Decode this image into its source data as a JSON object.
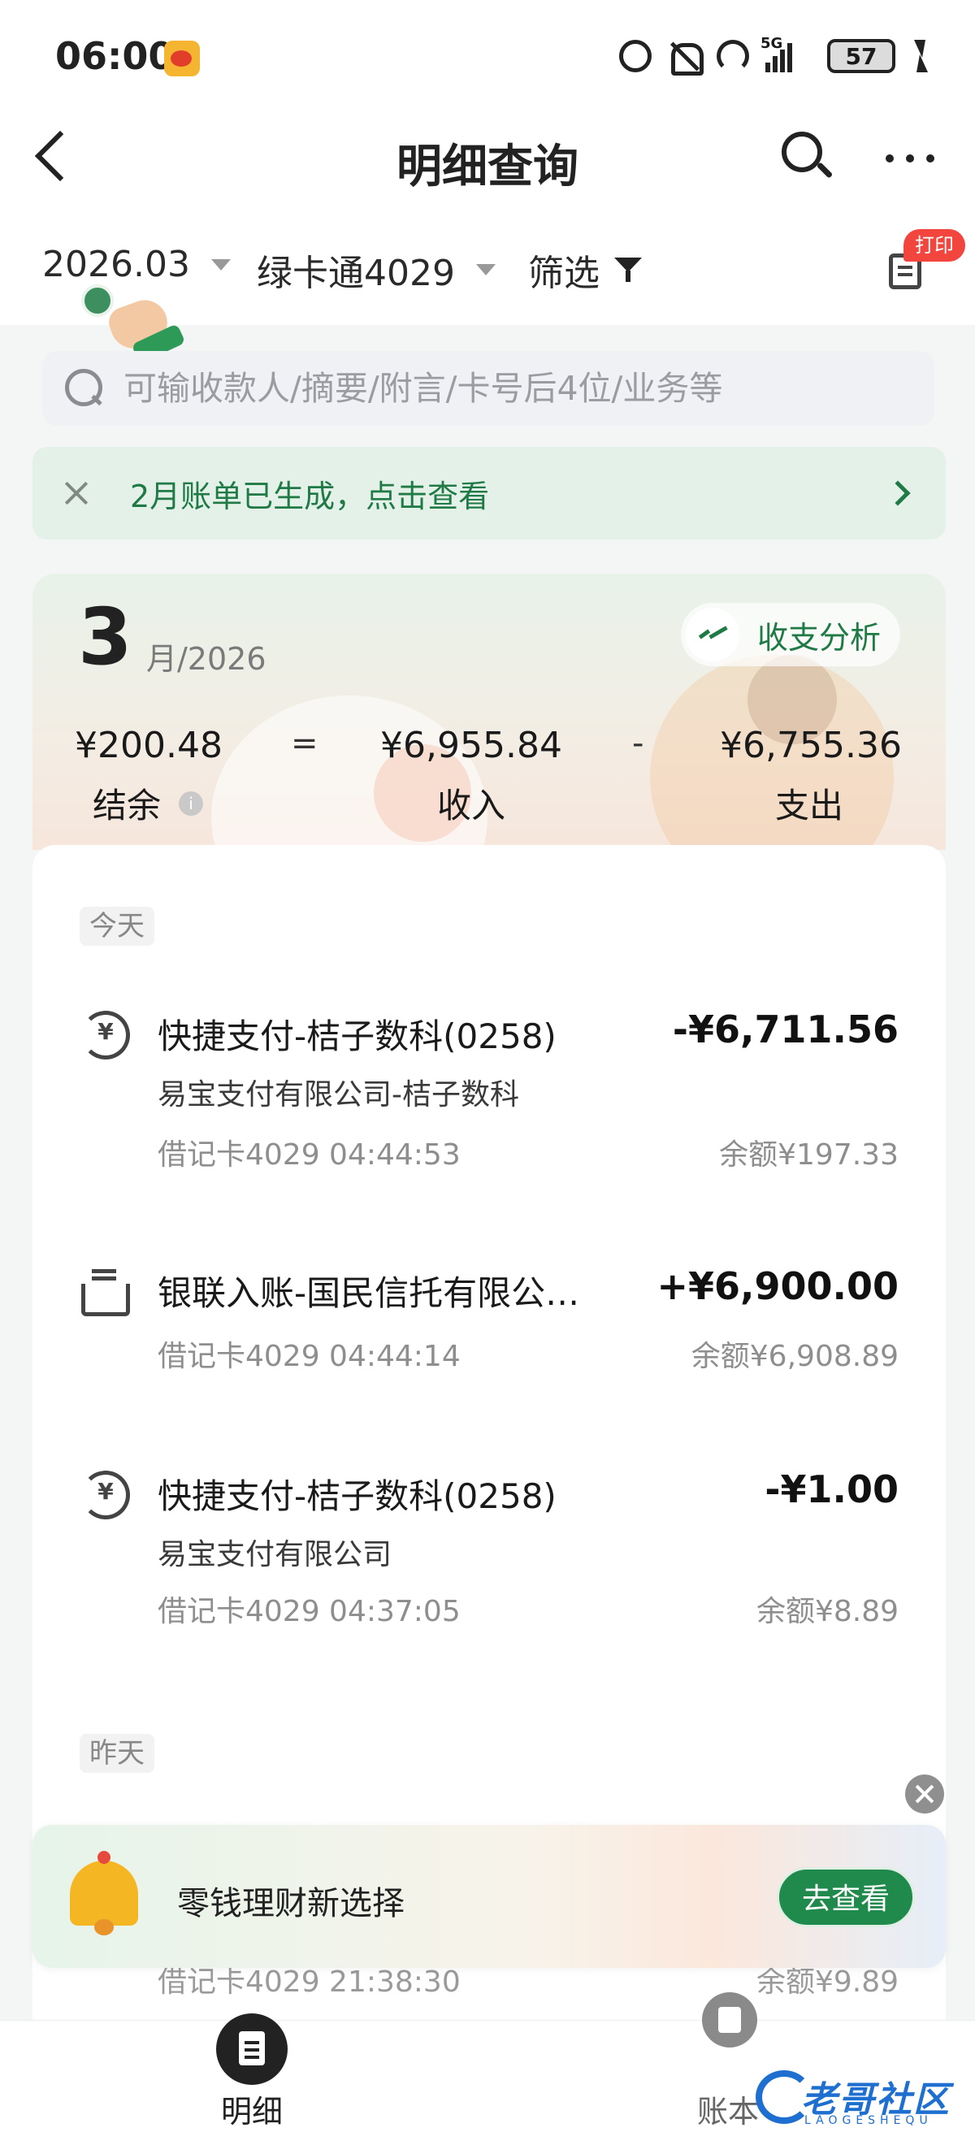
{
  "status_bar": {
    "time": "06:00",
    "network": "5G",
    "sim_slot": "1",
    "battery": "57"
  },
  "header": {
    "title": "明细查询"
  },
  "filters": {
    "month": "2026.03",
    "account": "绿卡通4029",
    "filter_label": "筛选",
    "print_badge": "打印"
  },
  "search": {
    "placeholder": "可输收款人/摘要/附言/卡号后4位/业务等"
  },
  "bill_banner": {
    "text": "2月账单已生成，点击查看"
  },
  "summary": {
    "month": "3",
    "month_year": "月/2026",
    "analysis_label": "收支分析",
    "balance_amount": "¥200.48",
    "balance_label": "结余",
    "equals": "=",
    "income_amount": "¥6,955.84",
    "income_label": "收入",
    "minus": "-",
    "expense_amount": "¥6,755.36",
    "expense_label": "支出"
  },
  "today_tag": "今天",
  "yesterday_tag": "昨天",
  "transactions": [
    {
      "title": "快捷支付-桔子数科(0258)",
      "subtitle": "易宝支付有限公司-桔子数科",
      "meta": "借记卡4029 04:44:53",
      "amount": "-¥6,711.56",
      "balance": "余额¥197.33",
      "icon": "payment-icon"
    },
    {
      "title": "银联入账-国民信托有限公…",
      "subtitle": "",
      "meta": "借记卡4029 04:44:14",
      "amount": "+¥6,900.00",
      "balance": "余额¥6,908.89",
      "icon": "inbox-icon"
    },
    {
      "title": "快捷支付-桔子数科(0258)",
      "subtitle": "易宝支付有限公司",
      "meta": "借记卡4029 04:37:05",
      "amount": "-¥1.00",
      "balance": "余额¥8.89",
      "icon": "payment-icon"
    }
  ],
  "peek_row": {
    "meta": "借记卡4029 21:38:30",
    "balance": "余额¥9.89"
  },
  "promo": {
    "text": "零钱理财新选择",
    "button": "去查看"
  },
  "tabs": [
    {
      "label": "明细"
    },
    {
      "label": "账本"
    }
  ],
  "watermark": {
    "text": "老哥社区",
    "sub": "LAOGESHEQU"
  },
  "colors": {
    "accent": "#1f7a46",
    "promo_button": "#1f8a4c",
    "badge": "#f2453d"
  }
}
